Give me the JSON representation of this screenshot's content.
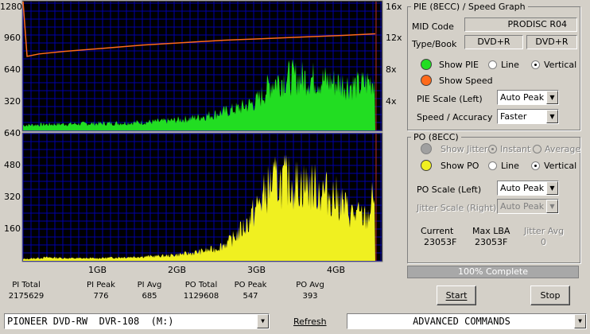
{
  "pie_graph": {
    "y_left_ticks": [
      "1280",
      "960",
      "640",
      "320"
    ],
    "y_right_ticks": [
      "16x",
      "12x",
      "8x",
      "4x"
    ]
  },
  "po_graph": {
    "y_left_ticks": [
      "640",
      "480",
      "320",
      "160"
    ]
  },
  "x_ticks": [
    "1GB",
    "2GB",
    "3GB",
    "4GB"
  ],
  "chart_data": [
    {
      "type": "area",
      "series": [
        {
          "name": "PIE",
          "x": [
            0.0,
            0.3,
            0.6,
            0.9,
            1.2,
            1.5,
            1.8,
            2.1,
            2.4,
            2.7,
            2.9,
            3.0,
            3.1,
            3.3,
            3.6,
            3.9,
            4.2,
            4.4
          ],
          "y": [
            60,
            70,
            75,
            80,
            85,
            95,
            110,
            140,
            190,
            260,
            330,
            420,
            560,
            620,
            610,
            560,
            520,
            600
          ]
        },
        {
          "name": "Speed",
          "x": [
            0.0,
            0.05,
            0.2,
            0.5,
            1.0,
            1.5,
            2.0,
            2.5,
            3.0,
            3.5,
            4.0,
            4.4
          ],
          "y": [
            16.0,
            9.2,
            9.5,
            9.8,
            10.2,
            10.6,
            10.9,
            11.2,
            11.4,
            11.6,
            11.8,
            12.0
          ]
        }
      ],
      "ylim": [
        0,
        1280
      ],
      "y2lim": [
        0,
        16
      ],
      "xlim": [
        0,
        4.48
      ],
      "grid": true
    },
    {
      "type": "area",
      "series": [
        {
          "name": "PO",
          "x": [
            0.0,
            0.3,
            0.6,
            0.9,
            1.2,
            1.5,
            1.8,
            2.1,
            2.4,
            2.6,
            2.8,
            2.9,
            3.0,
            3.1,
            3.3,
            3.6,
            3.9,
            4.1,
            4.3,
            4.4
          ],
          "y": [
            10,
            20,
            15,
            15,
            20,
            25,
            30,
            45,
            70,
            120,
            220,
            300,
            380,
            460,
            470,
            440,
            380,
            280,
            250,
            420
          ]
        }
      ],
      "ylim": [
        0,
        640
      ],
      "xlim": [
        0,
        4.48
      ],
      "grid": true
    }
  ],
  "stats": [
    {
      "label": "PI Total",
      "value": "2175629"
    },
    {
      "label": "PI Peak",
      "value": "776"
    },
    {
      "label": "PI Avg",
      "value": "685"
    },
    {
      "label": "PO Total",
      "value": "1129608"
    },
    {
      "label": "PO Peak",
      "value": "547"
    },
    {
      "label": "PO Avg",
      "value": "393"
    }
  ],
  "pie_group": {
    "title": "PIE (8ECC) / Speed Graph",
    "mid_code_label": "MID Code",
    "mid_code_value": "PRODISC R04",
    "type_book_label": "Type/Book",
    "type_value": "DVD+R",
    "book_value": "DVD+R",
    "show_pie": "Show PIE",
    "show_speed": "Show Speed",
    "line": "Line",
    "vertical": "Vertical",
    "pie_scale_label": "PIE Scale (Left)",
    "pie_scale_value": "Auto Peak",
    "speed_label": "Speed / Accuracy",
    "speed_value": "Faster",
    "pie_color": "#22dd22",
    "speed_color": "#ff6a1a"
  },
  "po_group": {
    "title": "PO (8ECC)",
    "show_jitter": "Show Jitter",
    "instant": "Instant",
    "average": "Average",
    "show_po": "Show PO",
    "line": "Line",
    "vertical": "Vertical",
    "po_scale_label": "PO Scale (Left)",
    "po_scale_value": "Auto Peak",
    "jitter_scale_label": "Jitter Scale (Right)",
    "jitter_scale_value": "Auto Peak",
    "current_label": "Current",
    "current_value": "23053F",
    "max_lba_label": "Max LBA",
    "max_lba_value": "23053F",
    "jitter_avg_label": "Jitter Avg",
    "jitter_avg_value": "0",
    "po_color": "#f0f020"
  },
  "progress": {
    "text": "100% Complete",
    "fraction": 1.0
  },
  "buttons": {
    "start": "Start",
    "stop": "Stop",
    "refresh": "Refresh"
  },
  "drive_select": "PIONEER DVD-RW  DVR-108  (M:)",
  "commands_select": "ADVANCED COMMANDS"
}
